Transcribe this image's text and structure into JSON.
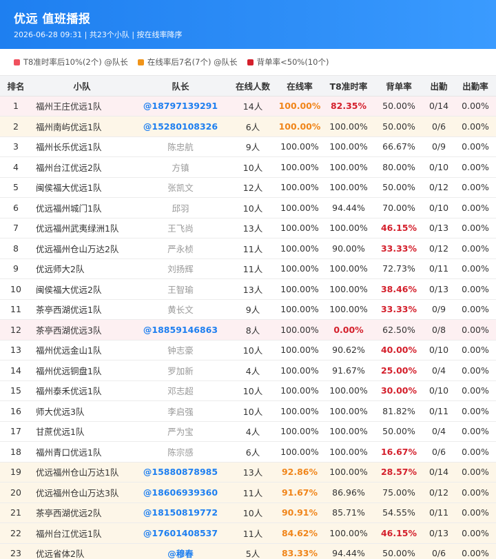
{
  "header": {
    "title": "优远 值班播报",
    "subtitle": "2026-06-28 09:31 | 共23个小队 | 按在线率降序"
  },
  "legend": [
    {
      "label": "T8准时率后10%(2个) @队长",
      "color": "#f0515e"
    },
    {
      "label": "在线率后7名(7个) @队长",
      "color": "#f0941a"
    },
    {
      "label": "背单率<50%(10个)",
      "color": "#d4202c"
    }
  ],
  "columns": [
    "排名",
    "小队",
    "队长",
    "在线人数",
    "在线率",
    "T8准时率",
    "背单率",
    "出勤",
    "出勤率"
  ],
  "rows": [
    {
      "rank": "1",
      "team": "福州王庄优远1队",
      "captain": "@18797139291",
      "online": "14人",
      "online_rate": "100.00%",
      "t8": "82.35%",
      "back": "50.00%",
      "attend": "0/14",
      "attend_rate": "0.00%",
      "hl": "red",
      "cap_phone": true,
      "online_rate_style": "orange",
      "t8_style": "red",
      "back_style": ""
    },
    {
      "rank": "2",
      "team": "福州南屿优远1队",
      "captain": "@15280108326",
      "online": "6人",
      "online_rate": "100.00%",
      "t8": "100.00%",
      "back": "50.00%",
      "attend": "0/6",
      "attend_rate": "0.00%",
      "hl": "orange",
      "cap_phone": true,
      "online_rate_style": "orange",
      "t8_style": "",
      "back_style": ""
    },
    {
      "rank": "3",
      "team": "福州长乐优远1队",
      "captain": "陈忠航",
      "online": "9人",
      "online_rate": "100.00%",
      "t8": "100.00%",
      "back": "66.67%",
      "attend": "0/9",
      "attend_rate": "0.00%",
      "hl": "",
      "cap_phone": false,
      "online_rate_style": "",
      "t8_style": "",
      "back_style": ""
    },
    {
      "rank": "4",
      "team": "福州台江优远2队",
      "captain": "方镇",
      "online": "10人",
      "online_rate": "100.00%",
      "t8": "100.00%",
      "back": "80.00%",
      "attend": "0/10",
      "attend_rate": "0.00%",
      "hl": "",
      "cap_phone": false,
      "online_rate_style": "",
      "t8_style": "",
      "back_style": ""
    },
    {
      "rank": "5",
      "team": "闽侯福大优远1队",
      "captain": "张凯文",
      "online": "12人",
      "online_rate": "100.00%",
      "t8": "100.00%",
      "back": "50.00%",
      "attend": "0/12",
      "attend_rate": "0.00%",
      "hl": "",
      "cap_phone": false,
      "online_rate_style": "",
      "t8_style": "",
      "back_style": ""
    },
    {
      "rank": "6",
      "team": "优远福州城门1队",
      "captain": "邱羽",
      "online": "10人",
      "online_rate": "100.00%",
      "t8": "94.44%",
      "back": "70.00%",
      "attend": "0/10",
      "attend_rate": "0.00%",
      "hl": "",
      "cap_phone": false,
      "online_rate_style": "",
      "t8_style": "",
      "back_style": ""
    },
    {
      "rank": "7",
      "team": "优远福州武夷绿洲1队",
      "captain": "王飞尚",
      "online": "13人",
      "online_rate": "100.00%",
      "t8": "100.00%",
      "back": "46.15%",
      "attend": "0/13",
      "attend_rate": "0.00%",
      "hl": "",
      "cap_phone": false,
      "online_rate_style": "",
      "t8_style": "",
      "back_style": "red"
    },
    {
      "rank": "8",
      "team": "优远福州仓山万达2队",
      "captain": "严永桢",
      "online": "11人",
      "online_rate": "100.00%",
      "t8": "90.00%",
      "back": "33.33%",
      "attend": "0/12",
      "attend_rate": "0.00%",
      "hl": "",
      "cap_phone": false,
      "online_rate_style": "",
      "t8_style": "",
      "back_style": "red"
    },
    {
      "rank": "9",
      "team": "优远师大2队",
      "captain": "刘扬辉",
      "online": "11人",
      "online_rate": "100.00%",
      "t8": "100.00%",
      "back": "72.73%",
      "attend": "0/11",
      "attend_rate": "0.00%",
      "hl": "",
      "cap_phone": false,
      "online_rate_style": "",
      "t8_style": "",
      "back_style": ""
    },
    {
      "rank": "10",
      "team": "闽侯福大优远2队",
      "captain": "王智瑜",
      "online": "13人",
      "online_rate": "100.00%",
      "t8": "100.00%",
      "back": "38.46%",
      "attend": "0/13",
      "attend_rate": "0.00%",
      "hl": "",
      "cap_phone": false,
      "online_rate_style": "",
      "t8_style": "",
      "back_style": "red"
    },
    {
      "rank": "11",
      "team": "茶亭西湖优远1队",
      "captain": "黄长文",
      "online": "9人",
      "online_rate": "100.00%",
      "t8": "100.00%",
      "back": "33.33%",
      "attend": "0/9",
      "attend_rate": "0.00%",
      "hl": "",
      "cap_phone": false,
      "online_rate_style": "",
      "t8_style": "",
      "back_style": "red"
    },
    {
      "rank": "12",
      "team": "茶亭西湖优远3队",
      "captain": "@18859146863",
      "online": "8人",
      "online_rate": "100.00%",
      "t8": "0.00%",
      "back": "62.50%",
      "attend": "0/8",
      "attend_rate": "0.00%",
      "hl": "red",
      "cap_phone": true,
      "online_rate_style": "",
      "t8_style": "red",
      "back_style": ""
    },
    {
      "rank": "13",
      "team": "福州优远金山1队",
      "captain": "钟志豪",
      "online": "10人",
      "online_rate": "100.00%",
      "t8": "90.62%",
      "back": "40.00%",
      "attend": "0/10",
      "attend_rate": "0.00%",
      "hl": "",
      "cap_phone": false,
      "online_rate_style": "",
      "t8_style": "",
      "back_style": "red"
    },
    {
      "rank": "14",
      "team": "福州优远铜盘1队",
      "captain": "罗加新",
      "online": "4人",
      "online_rate": "100.00%",
      "t8": "91.67%",
      "back": "25.00%",
      "attend": "0/4",
      "attend_rate": "0.00%",
      "hl": "",
      "cap_phone": false,
      "online_rate_style": "",
      "t8_style": "",
      "back_style": "red"
    },
    {
      "rank": "15",
      "team": "福州泰禾优远1队",
      "captain": "邓志超",
      "online": "10人",
      "online_rate": "100.00%",
      "t8": "100.00%",
      "back": "30.00%",
      "attend": "0/10",
      "attend_rate": "0.00%",
      "hl": "",
      "cap_phone": false,
      "online_rate_style": "",
      "t8_style": "",
      "back_style": "red"
    },
    {
      "rank": "16",
      "team": "师大优远3队",
      "captain": "李启强",
      "online": "10人",
      "online_rate": "100.00%",
      "t8": "100.00%",
      "back": "81.82%",
      "attend": "0/11",
      "attend_rate": "0.00%",
      "hl": "",
      "cap_phone": false,
      "online_rate_style": "",
      "t8_style": "",
      "back_style": ""
    },
    {
      "rank": "17",
      "team": "甘蔗优远1队",
      "captain": "严为宝",
      "online": "4人",
      "online_rate": "100.00%",
      "t8": "100.00%",
      "back": "50.00%",
      "attend": "0/4",
      "attend_rate": "0.00%",
      "hl": "",
      "cap_phone": false,
      "online_rate_style": "",
      "t8_style": "",
      "back_style": ""
    },
    {
      "rank": "18",
      "team": "福州青口优远1队",
      "captain": "陈宗感",
      "online": "6人",
      "online_rate": "100.00%",
      "t8": "100.00%",
      "back": "16.67%",
      "attend": "0/6",
      "attend_rate": "0.00%",
      "hl": "",
      "cap_phone": false,
      "online_rate_style": "",
      "t8_style": "",
      "back_style": "red"
    },
    {
      "rank": "19",
      "team": "优远福州仓山万达1队",
      "captain": "@15880878985",
      "online": "13人",
      "online_rate": "92.86%",
      "t8": "100.00%",
      "back": "28.57%",
      "attend": "0/14",
      "attend_rate": "0.00%",
      "hl": "orange",
      "cap_phone": true,
      "online_rate_style": "orange",
      "t8_style": "",
      "back_style": "red"
    },
    {
      "rank": "20",
      "team": "优远福州仓山万达3队",
      "captain": "@18606939360",
      "online": "11人",
      "online_rate": "91.67%",
      "t8": "86.96%",
      "back": "75.00%",
      "attend": "0/12",
      "attend_rate": "0.00%",
      "hl": "orange",
      "cap_phone": true,
      "online_rate_style": "orange",
      "t8_style": "",
      "back_style": ""
    },
    {
      "rank": "21",
      "team": "茶亭西湖优远2队",
      "captain": "@18150819772",
      "online": "10人",
      "online_rate": "90.91%",
      "t8": "85.71%",
      "back": "54.55%",
      "attend": "0/11",
      "attend_rate": "0.00%",
      "hl": "orange",
      "cap_phone": true,
      "online_rate_style": "orange",
      "t8_style": "",
      "back_style": ""
    },
    {
      "rank": "22",
      "team": "福州台江优远1队",
      "captain": "@17601408537",
      "online": "11人",
      "online_rate": "84.62%",
      "t8": "100.00%",
      "back": "46.15%",
      "attend": "0/13",
      "attend_rate": "0.00%",
      "hl": "orange",
      "cap_phone": true,
      "online_rate_style": "orange",
      "t8_style": "",
      "back_style": "red"
    },
    {
      "rank": "23",
      "team": "优远省体2队",
      "captain": "@穆春",
      "online": "5人",
      "online_rate": "83.33%",
      "t8": "94.44%",
      "back": "50.00%",
      "attend": "0/6",
      "attend_rate": "0.00%",
      "hl": "orange",
      "cap_phone": true,
      "online_rate_style": "orange",
      "t8_style": "",
      "back_style": ""
    }
  ]
}
